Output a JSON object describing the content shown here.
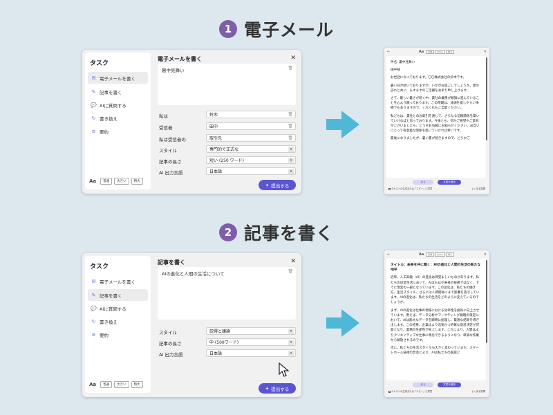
{
  "steps": [
    {
      "number": "1",
      "title": "電子メール",
      "panel": {
        "sidebar": {
          "title": "タスク",
          "items": [
            {
              "label": "電子メールを書く",
              "icon": "envelope-icon"
            },
            {
              "label": "記事を書く",
              "icon": "edit-icon"
            },
            {
              "label": "AIに質問する",
              "icon": "chat-icon"
            },
            {
              "label": "書き換え",
              "icon": "rewrite-icon"
            },
            {
              "label": "要約",
              "icon": "list-icon"
            }
          ],
          "font_sizes": [
            "普通",
            "大きい",
            "特大"
          ]
        },
        "title": "電子メールを書く",
        "textarea_value": "暑中見舞い",
        "fields": [
          {
            "label": "私は",
            "value": "鈴木"
          },
          {
            "label": "受信者",
            "value": "田中"
          },
          {
            "label": "私は受信者の",
            "value": "取引先"
          },
          {
            "label": "スタイル",
            "value": "専門的で正式な"
          },
          {
            "label": "記事の長さ",
            "value": "短い (250 ワード)"
          },
          {
            "label": "AI 出力言語",
            "value": "日本語"
          }
        ],
        "submit_label": "提出する"
      },
      "doc": {
        "paragraphs": [
          "件名: 暑中見舞い",
          "田中様",
          "お世話になっております。〇〇株式会社の鈴木です。",
          "暑い日が続いておりますが、いかがお過ごしでしょうか。夏の訪れと共に、ますますのご活躍をお祈り申し上げます。",
          "さて、厳しい暑さが続く中、貴社の業務が順調に進んでいることを心より願っております。この時期は、体調を崩しやすい季節でもありますので、くれぐれもご自愛ください。",
          "私どもは、貴社とのお取引を通じて、さらなる信頼関係を築いていければと思っております。今後とも、何かご要望やご意見がございましたら、どうぞお気軽にお知らせください。お互いにとって有意義な関係を築いていければ幸いです。",
          "最後になりましたが、暑い夏が続きますので、どうかご"
        ],
        "back_label": "戻る",
        "apply_label": "文書を適用",
        "checkbox_label": "テキストの生成または「コピー」に同意",
        "link_label": "よくある質問"
      }
    },
    {
      "number": "2",
      "title": "記事を書く",
      "panel": {
        "sidebar": {
          "title": "タスク",
          "items": [
            {
              "label": "電子メールを書く",
              "icon": "envelope-icon"
            },
            {
              "label": "記事を書く",
              "icon": "edit-icon"
            },
            {
              "label": "AIに質問する",
              "icon": "chat-icon"
            },
            {
              "label": "書き換え",
              "icon": "rewrite-icon"
            },
            {
              "label": "要約",
              "icon": "list-icon"
            }
          ],
          "font_sizes": [
            "普通",
            "大きい",
            "特大"
          ]
        },
        "title": "記事を書く",
        "textarea_value": "AIの進化と人間の生活について",
        "fields": [
          {
            "label": "スタイル",
            "value": "説得と議論"
          },
          {
            "label": "記事の長さ",
            "value": "中 (500ワード)"
          },
          {
            "label": "AI 出力言語",
            "value": "日本語"
          }
        ],
        "submit_label": "提出する"
      },
      "doc": {
        "paragraphs": [
          "タイトル：未来を共に築く：AIの進化と人間の生活の新たな地平",
          "近年、人工知能（AI）の進化は目覚ましいものがあります。私たちの日常生活において、AIはもはや未来の技術ではなく、すでに現実の一部となっています。この変化は、私たちの働き方、生活スタイル、さらには人間関係にまで影響を及ぼしています。AIの進化は、私たちの生活をどのように変えているのでしょうか。",
          "まず、AIの進化は仕事の現場における効率性を劇的に向上させています。例えば、データ分析やマーケティング戦略の策定において、AIは膨大なデータを瞬時に処理し、最適な結果を導き出します。この結果、企業はより迅速かつ的確な意思決定が可能となり、業務の生産性が向上します。これにより、人間はよりクリエイティブな仕事に専念できるようになり、単調な作業から解放されるのです。",
          "次に、私たちの生活スタイルも大きく変わっています。スマートホーム技術の普及により、AIは私たちの家庭に"
        ],
        "back_label": "戻る",
        "apply_label": "文書を適用",
        "checkbox_label": "テキストの生成または「コピー」に同意",
        "link_label": "よくある質問"
      }
    }
  ],
  "colors": {
    "background": "#dde8ee",
    "step_badge": "#7e5ea8",
    "accent": "#5a56d1",
    "arrow": "#4fb8d6"
  }
}
